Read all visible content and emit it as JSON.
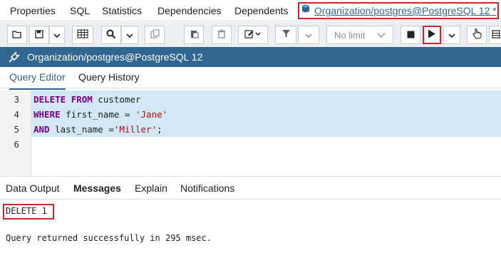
{
  "top_tabs": {
    "properties": "Properties",
    "sql": "SQL",
    "statistics": "Statistics",
    "dependencies": "Dependencies",
    "dependents": "Dependents",
    "active_query": "Organization/postgres@PostgreSQL 12 *"
  },
  "toolbar": {
    "limit_value": "No limit",
    "icons": [
      "open-file-icon",
      "save-icon",
      "chevron-down-icon",
      "grid-icon",
      "search-icon",
      "chevron-down-icon",
      "copy-icon",
      "paste-icon",
      "delete-icon",
      "edit-icon",
      "chevron-down-icon",
      "filter-icon",
      "chevron-down-icon",
      "stop-icon",
      "execute-icon",
      "chevron-down-icon",
      "hand-icon",
      "more-icon"
    ]
  },
  "connection": {
    "title": "Organization/postgres@PostgreSQL 12",
    "icon": "connection-plug-icon"
  },
  "editor_tabs": {
    "query_editor": "Query Editor",
    "query_history": "Query History"
  },
  "editor": {
    "line_numbers": [
      "3",
      "4",
      "5",
      "6"
    ],
    "line3_kw1": "DELETE",
    "line3_kw2": "FROM",
    "line3_rest": " customer",
    "line4_kw": "WHERE",
    "line4_mid": " first_name = ",
    "line4_str": "'Jane'",
    "line5_kw": "AND",
    "line5_mid": " last_name =",
    "line5_str": "'Miller'",
    "line5_end": ";"
  },
  "output_tabs": {
    "data_output": "Data Output",
    "messages": "Messages",
    "explain": "Explain",
    "notifications": "Notifications"
  },
  "messages": {
    "result": "DELETE 1",
    "status": "Query returned successfully in 295 msec."
  },
  "colors": {
    "accent": "#326690",
    "highlight_border": "#d0272d",
    "selection": "#d3e8f7"
  }
}
